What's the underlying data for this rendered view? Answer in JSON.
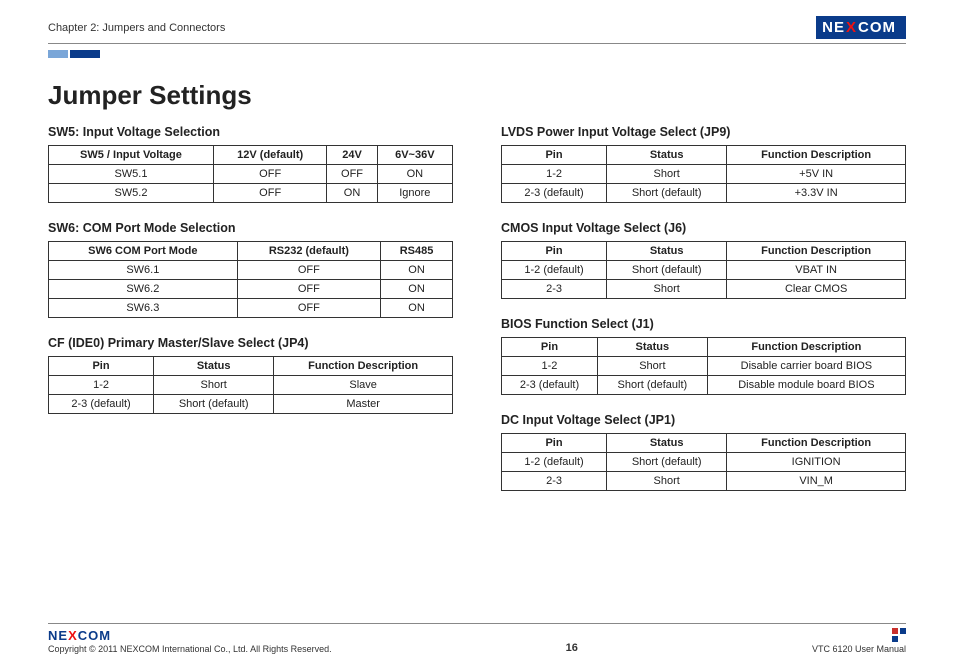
{
  "header": {
    "chapter": "Chapter 2: Jumpers and Connectors",
    "brand": "NE",
    "brand_x": "X",
    "brand_end": "COM"
  },
  "title": "Jumper Settings",
  "left_sections": [
    {
      "title": "SW5: Input Voltage Selection",
      "headers": [
        "SW5 / Input Voltage",
        "12V (default)",
        "24V",
        "6V~36V"
      ],
      "rows": [
        [
          "SW5.1",
          "OFF",
          "OFF",
          "ON"
        ],
        [
          "SW5.2",
          "OFF",
          "ON",
          "Ignore"
        ]
      ]
    },
    {
      "title": "SW6: COM Port Mode Selection",
      "headers": [
        "SW6 COM Port Mode",
        "RS232 (default)",
        "RS485"
      ],
      "rows": [
        [
          "SW6.1",
          "OFF",
          "ON"
        ],
        [
          "SW6.2",
          "OFF",
          "ON"
        ],
        [
          "SW6.3",
          "OFF",
          "ON"
        ]
      ]
    },
    {
      "title": "CF (IDE0) Primary Master/Slave Select (JP4)",
      "headers": [
        "Pin",
        "Status",
        "Function Description"
      ],
      "rows": [
        [
          "1-2",
          "Short",
          "Slave"
        ],
        [
          "2-3 (default)",
          "Short (default)",
          "Master"
        ]
      ]
    }
  ],
  "right_sections": [
    {
      "title": "LVDS Power Input Voltage Select (JP9)",
      "headers": [
        "Pin",
        "Status",
        "Function Description"
      ],
      "rows": [
        [
          "1-2",
          "Short",
          "+5V IN"
        ],
        [
          "2-3 (default)",
          "Short (default)",
          "+3.3V IN"
        ]
      ]
    },
    {
      "title": "CMOS Input Voltage Select (J6)",
      "headers": [
        "Pin",
        "Status",
        "Function Description"
      ],
      "rows": [
        [
          "1-2 (default)",
          "Short (default)",
          "VBAT IN"
        ],
        [
          "2-3",
          "Short",
          "Clear CMOS"
        ]
      ]
    },
    {
      "title": "BIOS Function Select (J1)",
      "headers": [
        "Pin",
        "Status",
        "Function Description"
      ],
      "rows": [
        [
          "1-2",
          "Short",
          "Disable carrier board BIOS"
        ],
        [
          "2-3 (default)",
          "Short (default)",
          "Disable module board BIOS"
        ]
      ]
    },
    {
      "title": "DC Input Voltage Select (JP1)",
      "headers": [
        "Pin",
        "Status",
        "Function Description"
      ],
      "rows": [
        [
          "1-2 (default)",
          "Short (default)",
          "IGNITION"
        ],
        [
          "2-3",
          "Short",
          "VIN_M"
        ]
      ]
    }
  ],
  "footer": {
    "copyright": "Copyright © 2011 NEXCOM International Co., Ltd. All Rights Reserved.",
    "page": "16",
    "manual": "VTC 6120 User Manual"
  }
}
